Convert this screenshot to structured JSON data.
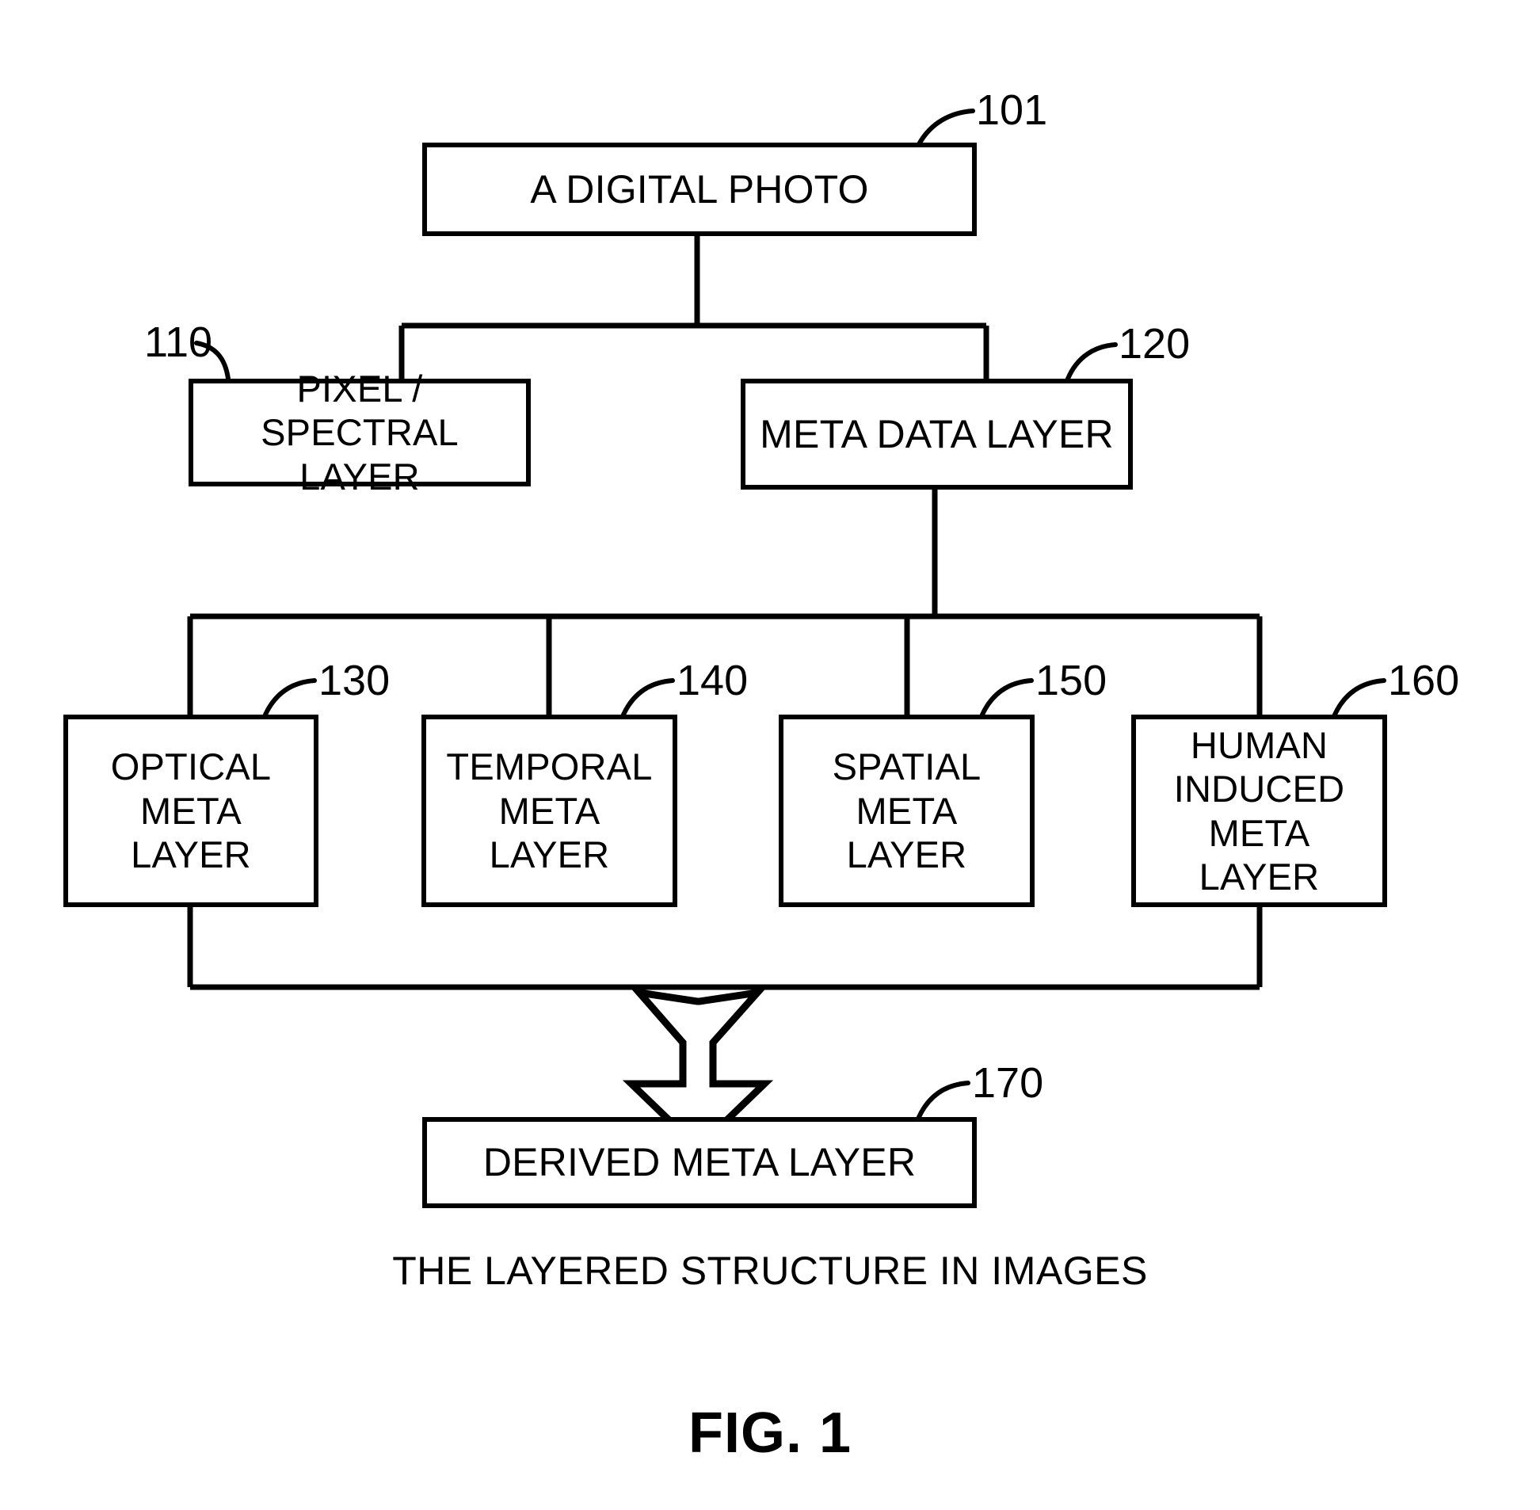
{
  "figure": {
    "caption": "THE LAYERED STRUCTURE IN IMAGES",
    "number": "FIG. 1",
    "line_color": "#000000",
    "background_color": "#ffffff"
  },
  "nodes": {
    "digital_photo": {
      "label": "A DIGITAL PHOTO",
      "ref": "101"
    },
    "pixel_spectral_layer": {
      "label": "PIXEL / SPECTRAL\nLAYER",
      "ref": "110"
    },
    "meta_data_layer": {
      "label": "META DATA LAYER",
      "ref": "120"
    },
    "optical_meta_layer": {
      "label": "OPTICAL\nMETA\nLAYER",
      "ref": "130"
    },
    "temporal_meta_layer": {
      "label": "TEMPORAL\nMETA\nLAYER",
      "ref": "140"
    },
    "spatial_meta_layer": {
      "label": "SPATIAL\nMETA\nLAYER",
      "ref": "150"
    },
    "human_induced_meta_layer": {
      "label": "HUMAN\nINDUCED\nMETA\nLAYER",
      "ref": "160"
    },
    "derived_meta_layer": {
      "label": "DERIVED META LAYER",
      "ref": "170"
    }
  },
  "arrow": {
    "name": "down-arrow-glyph"
  }
}
